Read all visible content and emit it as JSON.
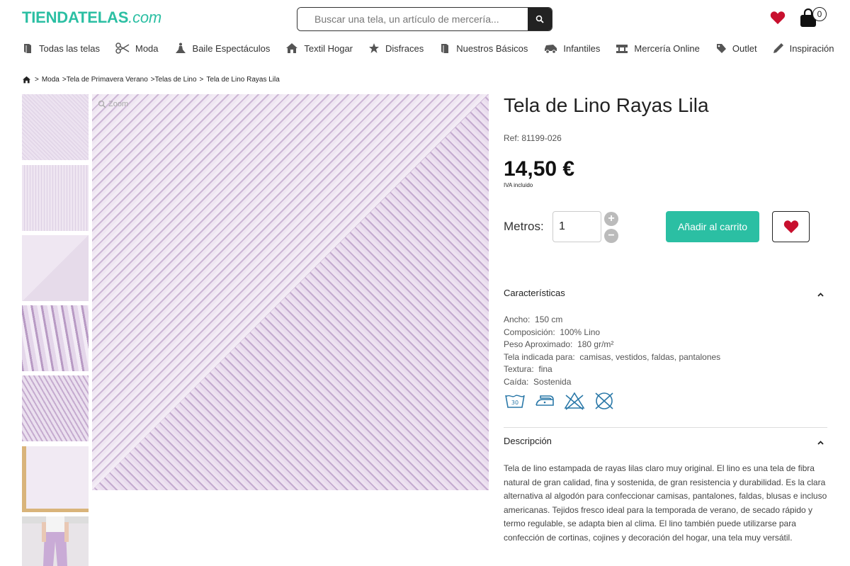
{
  "header": {
    "logo_main": "TIENDATELAS",
    "logo_suffix": ".com",
    "search_placeholder": "Buscar una tela, un artículo de mercería...",
    "cart_count": "0"
  },
  "nav": {
    "items": [
      {
        "label": "Todas las telas",
        "icon": "fabric-roll-icon"
      },
      {
        "label": "Moda",
        "icon": "scissors-icon"
      },
      {
        "label": "Baile Espectáculos",
        "icon": "dancer-icon"
      },
      {
        "label": "Textil Hogar",
        "icon": "home-icon"
      },
      {
        "label": "Disfraces",
        "icon": "star-icon"
      },
      {
        "label": "Nuestros Básicos",
        "icon": "fabric-roll-icon"
      },
      {
        "label": "Infantiles",
        "icon": "toy-car-icon"
      },
      {
        "label": "Mercería Online",
        "icon": "sewing-machine-icon"
      },
      {
        "label": "Outlet",
        "icon": "tag-icon"
      },
      {
        "label": "Inspiración",
        "icon": "pencil-icon"
      }
    ]
  },
  "breadcrumb": {
    "items": [
      "Moda",
      ">Tela de Primavera Verano",
      ">Telas de Lino",
      "Tela de Lino Rayas Lila"
    ]
  },
  "product": {
    "zoom_label": "Zoom",
    "title": "Tela de Lino Rayas Lila",
    "ref": "Ref: 81199-026",
    "price": "14,50 €",
    "iva": "IVA incluido",
    "metros_label": "Metros:",
    "quantity": "1",
    "add_to_cart": "Añadir al carrito"
  },
  "characteristics": {
    "heading": "Características",
    "rows": [
      {
        "label": "Ancho:",
        "value": "150 cm"
      },
      {
        "label": "Composición:",
        "value": "100% Lino"
      },
      {
        "label": "Peso Aproximado:",
        "value": "180 gr/m²"
      },
      {
        "label": "Tela indicada para:",
        "value": "camisas, vestidos, faldas, pantalones"
      },
      {
        "label": "Textura:",
        "value": "fina"
      },
      {
        "label": "Caída:",
        "value": "Sostenida"
      }
    ],
    "wash_temp": "30"
  },
  "description": {
    "heading": "Descripción",
    "text": "Tela de lino estampada de rayas lilas claro muy original. El lino es una tela de fibra natural de gran calidad, fina y sostenida, de gran resistencia y durabilidad. Es la clara alternativa al algodón para confeccionar camisas, pantalones, faldas, blusas e incluso americanas. Tejidos fresco ideal para la temporada de verano, de secado rápido y termo regulable, se adapta bien al clima. El lino también puede utilizarse para confección de cortinas, cojines y decoración del hogar, una tela muy versátil."
  },
  "colors": {
    "accent": "#2bbfa3",
    "heart": "#c8102e",
    "care_icons": "#2a78a8"
  }
}
